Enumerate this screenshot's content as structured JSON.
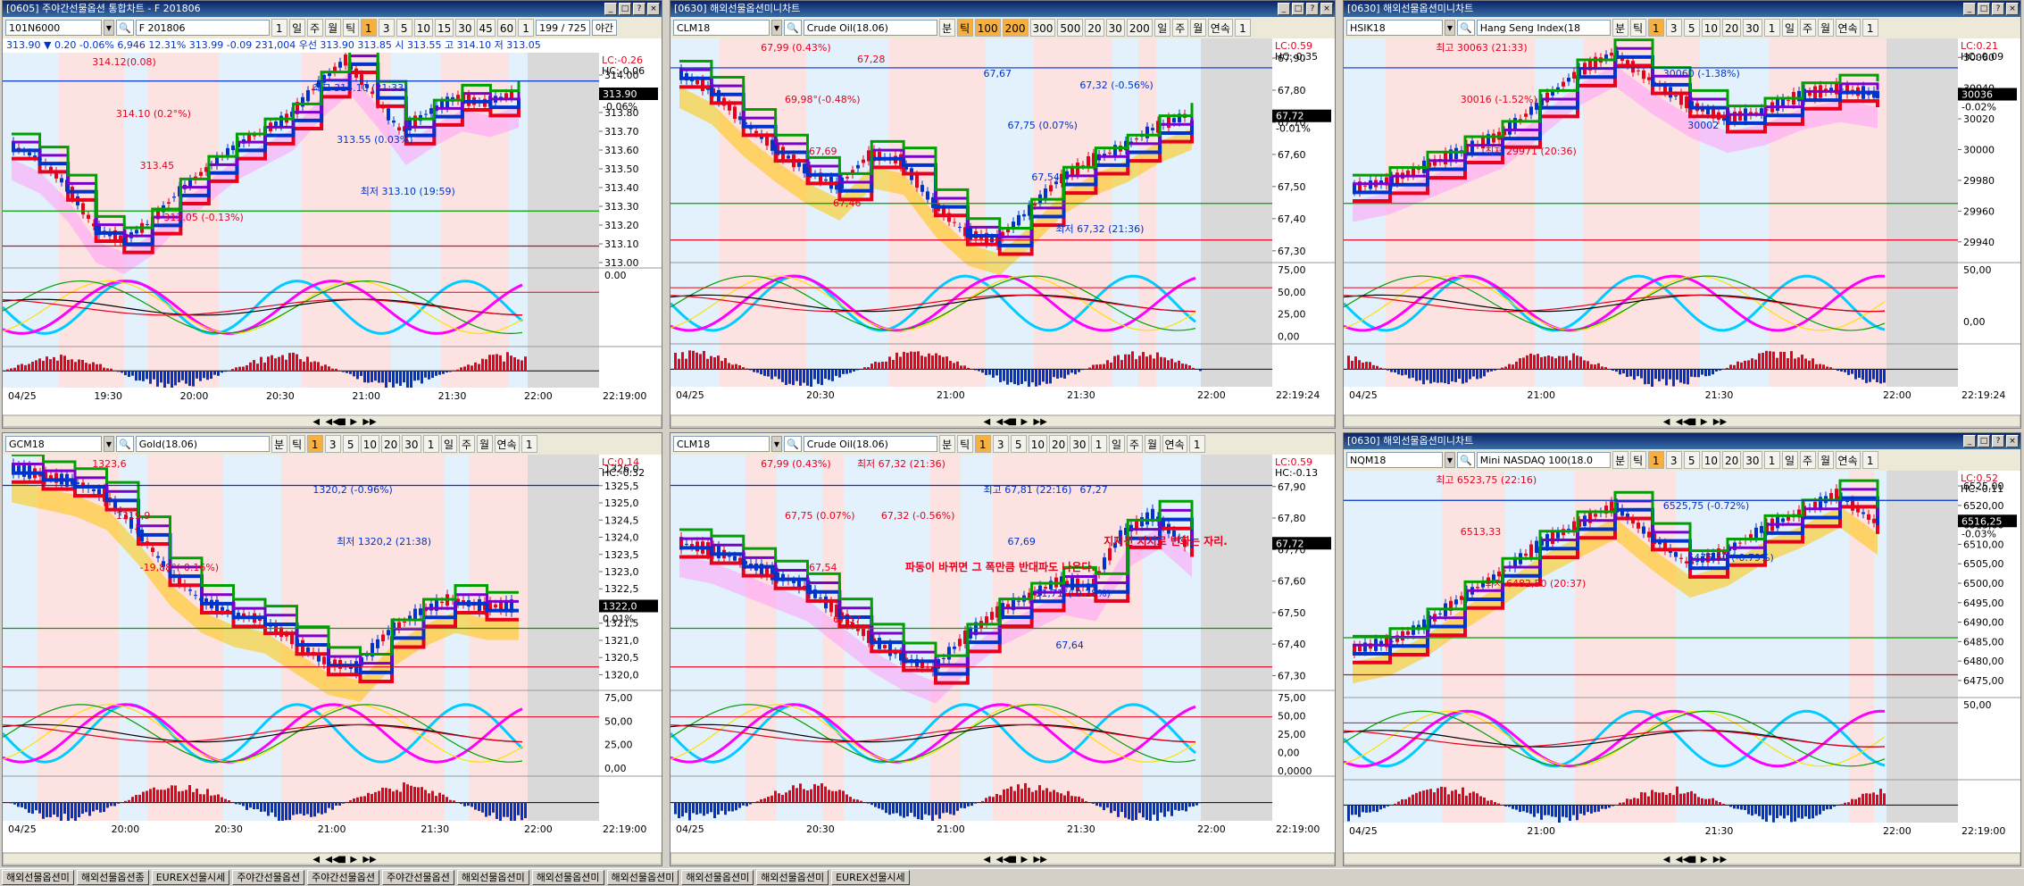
{
  "chart_data": [
    {
      "type": "line",
      "title": "[0605] 주야간선물옵션 통합차트 - F 201806",
      "code": "101N6000",
      "name": "F 201806",
      "toolbar": [
        "1",
        "일",
        "주",
        "월",
        "틱",
        "1",
        "3",
        "5",
        "10",
        "15",
        "30",
        "45",
        "60",
        "1"
      ],
      "counter": "199 / 725",
      "mode": "야간",
      "info": "313.90 ▼ 0.20 -0.06%  6,946 12.31%  313.99 -0.09 231,004  우선  313.90  313.85 시 313.55 고 314.10 저 313.05",
      "yticks": [
        "314.00",
        "313.90",
        "313.80",
        "313.70",
        "313.60",
        "313.50",
        "313.40",
        "313.30",
        "313.20",
        "313.10",
        "313.00"
      ],
      "ylim": [
        313.0,
        314.1
      ],
      "lc": "LC:-0.26",
      "hc": "HC:-0.06",
      "current": "313.90",
      "current_pct": "-0.06%",
      "annotations": [
        "314.12(0.08)",
        "최고 314.10 (21:33)",
        "314.10 (0.2°%)",
        "313.55 (0.03%)",
        "313.45",
        "최저 313.10 (19:59)",
        "313.05 (-0.13%)"
      ],
      "sub_yticks": [
        "0.00"
      ],
      "xticks": [
        "04/25",
        "19:30",
        "20:00",
        "20:30",
        "21:00",
        "21:30",
        "22:00"
      ],
      "clock": "22:19:00",
      "series": [
        {
          "values": [
            313.62,
            313.55,
            313.4,
            313.18,
            313.12,
            313.22,
            313.38,
            313.5,
            313.62,
            313.7,
            313.78,
            313.95,
            314.08,
            313.9,
            313.7,
            313.8,
            313.88,
            313.85,
            313.9
          ]
        }
      ]
    },
    {
      "type": "line",
      "title": "[0630] 해외선물옵션미니차트",
      "code": "CLM18",
      "name": "Crude Oil(18.06)",
      "toolbar": [
        "분",
        "틱",
        "100",
        "200",
        "300",
        "500",
        "20",
        "30",
        "200",
        "일",
        "주",
        "월",
        "연속",
        "1"
      ],
      "yticks": [
        "67,90",
        "67,80",
        "67,70",
        "67,60",
        "67,50",
        "67,40",
        "67,30"
      ],
      "ylim": [
        67.28,
        67.95
      ],
      "lc": "LC:0.59",
      "hc": "HC:-0.35",
      "current": "67,72",
      "current_pct": "-0.01%",
      "annotations": [
        "67,99 (0.43%)",
        "67,67",
        "69,98°(-0.48%)",
        "67,75 (0.07%)",
        "67,69",
        "67,54",
        "67,46",
        "최저 67,32 (21:36)",
        "67,28",
        "67,32 (-0.56%)"
      ],
      "sub_yticks": [
        "75,00",
        "50,00",
        "25,00",
        "0,00"
      ],
      "xticks": [
        "04/25",
        "20:30",
        "21:00",
        "21:30",
        "22:00"
      ],
      "clock": "22:19:24",
      "series": [
        {
          "values": [
            67.85,
            67.8,
            67.7,
            67.62,
            67.55,
            67.5,
            67.6,
            67.58,
            67.45,
            67.36,
            67.33,
            67.42,
            67.52,
            67.58,
            67.62,
            67.68,
            67.72
          ]
        }
      ]
    },
    {
      "type": "line",
      "title": "[0630] 해외선물옵션미니차트",
      "code": "HSIK18",
      "name": "Hang Seng Index(18",
      "toolbar": [
        "분",
        "틱",
        "1",
        "3",
        "5",
        "10",
        "20",
        "30",
        "1",
        "일",
        "주",
        "월",
        "연속",
        "1"
      ],
      "yticks": [
        "30060",
        "30040",
        "30020",
        "30000",
        "29980",
        "29960",
        "29940"
      ],
      "ylim": [
        29930,
        30070
      ],
      "lc": "LC:0.21",
      "hc": "HC:-0.09",
      "current": "30036",
      "current_pct": "-0.02%",
      "annotations": [
        "최고 30063 (21:33)",
        "30060 (-1.38%)",
        "30016 (-1.52%)",
        "30002",
        "최저 29971 (20:36)"
      ],
      "sub_yticks": [
        "50,00",
        "0,00"
      ],
      "xticks": [
        "04/25",
        "21:00",
        "21:30",
        "22:00"
      ],
      "clock": "22:19:24",
      "series": [
        {
          "values": [
            29975,
            29980,
            29990,
            30000,
            30010,
            30030,
            30050,
            30063,
            30045,
            30030,
            30020,
            30025,
            30035,
            30040,
            30036
          ]
        }
      ]
    },
    {
      "type": "line",
      "title": "",
      "code": "GCM18",
      "name": "Gold(18.06)",
      "toolbar": [
        "분",
        "틱",
        "1",
        "3",
        "5",
        "10",
        "20",
        "30",
        "1",
        "일",
        "주",
        "월",
        "연속",
        "1"
      ],
      "yticks": [
        "1326,0",
        "1325,5",
        "1325,0",
        "1324,5",
        "1324,0",
        "1323,5",
        "1323,0",
        "1322,5",
        "1322,0",
        "1321,5",
        "1321,0",
        "1320,5",
        "1320,0"
      ],
      "ylim": [
        1319.7,
        1326.3
      ],
      "lc": "LC:0.14",
      "hc": "HC:-0.32",
      "current": "1322,0",
      "current_pct": "0.01%",
      "annotations": [
        "1323,6",
        "1320,2 (-0.96%)",
        "1319,9",
        "최저 1320,2 (21:38)",
        "-19,88°(-0.16%)"
      ],
      "sub_yticks": [
        "75,00",
        "50,00",
        "25,00",
        "0,00"
      ],
      "xticks": [
        "04/25",
        "20:00",
        "20:30",
        "21:00",
        "21:30",
        "22:00"
      ],
      "clock": "22:19:00",
      "series": [
        {
          "values": [
            1326.0,
            1325.8,
            1325.6,
            1325.2,
            1324.2,
            1323.0,
            1322.2,
            1321.8,
            1321.6,
            1321.0,
            1320.4,
            1320.2,
            1321.2,
            1321.8,
            1322.2,
            1322.0,
            1322.0
          ]
        }
      ]
    },
    {
      "type": "line",
      "title": "",
      "code": "CLM18",
      "name": "Crude Oil(18.06)",
      "toolbar": [
        "분",
        "틱",
        "1",
        "3",
        "5",
        "10",
        "20",
        "30",
        "1",
        "일",
        "주",
        "월",
        "연속",
        "1"
      ],
      "yticks": [
        "67,90",
        "67,80",
        "67,70",
        "67,60",
        "67,50",
        "67,40",
        "67,30"
      ],
      "ylim": [
        67.27,
        67.99
      ],
      "lc": "LC:0.59",
      "hc": "HC:-0.13",
      "current": "67,72",
      "current_pct": "",
      "annotations": [
        "67,99 (0.43%)",
        "최고 67,81 (22:16)",
        "67,75 (0.07%)",
        "67,69",
        "67,54",
        "-11,71°(-0.28%)",
        "67,57",
        "67,64",
        "최저 67,32 (21:36)",
        "67,27",
        "67,32 (-0.56%)",
        "지지선 지지로 변화는 자리.",
        "파동이 바뀌면 그 폭만큼 반대파도 나온다."
      ],
      "sub_yticks": [
        "75,00",
        "50,00",
        "25,00",
        "0,00",
        "0,0000"
      ],
      "xticks": [
        "04/25",
        "20:30",
        "21:00",
        "21:30",
        "22:00"
      ],
      "clock": "22:19:00",
      "series": [
        {
          "values": [
            67.72,
            67.7,
            67.66,
            67.62,
            67.58,
            67.5,
            67.42,
            67.36,
            67.32,
            67.42,
            67.5,
            67.55,
            67.6,
            67.58,
            67.75,
            67.81,
            67.72
          ]
        }
      ]
    },
    {
      "type": "line",
      "title": "[0630] 해외선물옵션미니차트",
      "code": "NQM18",
      "name": "Mini NASDAQ 100(18.0",
      "toolbar": [
        "분",
        "틱",
        "1",
        "3",
        "5",
        "10",
        "20",
        "30",
        "1",
        "일",
        "주",
        "월",
        "연속",
        "1"
      ],
      "yticks": [
        "6525,00",
        "6520,00",
        "6515,00",
        "6510,00",
        "6505,00",
        "6500,00",
        "6495,00",
        "6490,00",
        "6485,00",
        "6480,00",
        "6475,00"
      ],
      "ylim": [
        6472,
        6528
      ],
      "lc": "LC:0.52",
      "hc": "HC:-0.11",
      "current": "6516,25",
      "current_pct": "-0.03%",
      "annotations": [
        "최고 6523,75 (22:16)",
        "6525,75 (-0.72%)",
        "6513,33",
        "6475,50 (-0.79%)",
        "최저 6482,50 (20:37)"
      ],
      "sub_yticks": [
        "50,00"
      ],
      "xticks": [
        "04/25",
        "21:00",
        "21:30",
        "22:00"
      ],
      "clock": "22:19:00",
      "series": [
        {
          "values": [
            6483,
            6485,
            6490,
            6497,
            6503,
            6510,
            6515,
            6520,
            6512,
            6505,
            6508,
            6514,
            6518,
            6523,
            6516
          ]
        }
      ]
    }
  ],
  "taskbar": [
    "해외선물옵션미",
    "해외선물옵션종",
    "EUREX선물시세",
    "주야간선물옵션",
    "주야간선물옵션",
    "주야간선물옵션",
    "해외선물옵션미",
    "해외선물옵션미",
    "해외선물옵션미",
    "해외선물옵션미",
    "해외선물옵션미",
    "EUREX선물시세"
  ],
  "colors": {
    "up": "#e8001c",
    "down": "#0033cc",
    "cloud": "#ff80ff",
    "cloud2": "#33ccff",
    "accent": "#f5b041"
  }
}
